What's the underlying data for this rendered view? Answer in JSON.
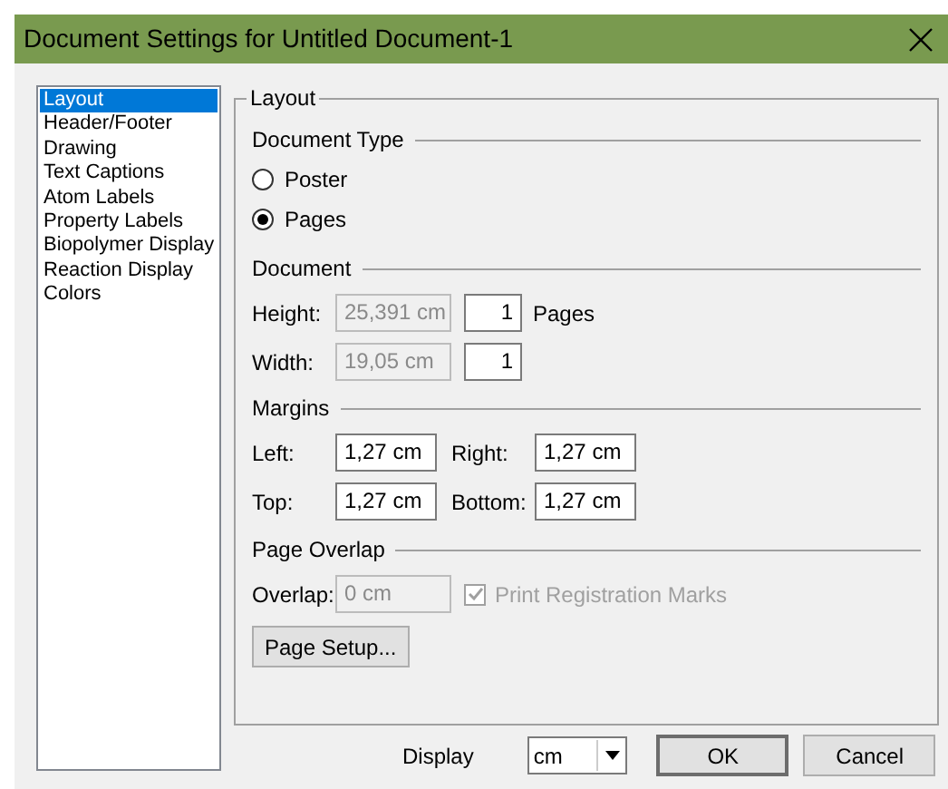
{
  "window": {
    "title": "Document Settings for Untitled Document-1"
  },
  "sidebar": {
    "items": [
      {
        "label": "Layout",
        "selected": true
      },
      {
        "label": "Header/Footer",
        "selected": false
      },
      {
        "label": "Drawing",
        "selected": false
      },
      {
        "label": "Text Captions",
        "selected": false
      },
      {
        "label": "Atom Labels",
        "selected": false
      },
      {
        "label": "Property Labels",
        "selected": false
      },
      {
        "label": "Biopolymer Display",
        "selected": false
      },
      {
        "label": "Reaction Display",
        "selected": false
      },
      {
        "label": "Colors",
        "selected": false
      }
    ]
  },
  "group": {
    "title": "Layout",
    "document_type": {
      "title": "Document Type",
      "options": [
        {
          "label": "Poster",
          "selected": false
        },
        {
          "label": "Pages",
          "selected": true
        }
      ]
    },
    "document": {
      "title": "Document",
      "rows": [
        {
          "label": "Height:",
          "size": "25,391 cm",
          "size_disabled": true,
          "count": "1",
          "unit": "Pages"
        },
        {
          "label": "Width:",
          "size": "19,05 cm",
          "size_disabled": true,
          "count": "1"
        }
      ]
    },
    "margins": {
      "title": "Margins",
      "fields": [
        {
          "label": "Left:",
          "value": "1,27 cm"
        },
        {
          "label": "Right:",
          "value": "1,27 cm"
        },
        {
          "label": "Top:",
          "value": "1,27 cm"
        },
        {
          "label": "Bottom:",
          "value": "1,27 cm"
        }
      ]
    },
    "page_overlap": {
      "title": "Page Overlap",
      "label": "Overlap:",
      "value": "0 cm",
      "disabled": true,
      "checkbox": {
        "label": "Print Registration Marks",
        "checked": true,
        "disabled": true
      }
    },
    "page_setup_button": "Page Setup..."
  },
  "footer": {
    "display_label": "Display",
    "display_value": "cm",
    "buttons": [
      "OK",
      "Cancel"
    ]
  }
}
